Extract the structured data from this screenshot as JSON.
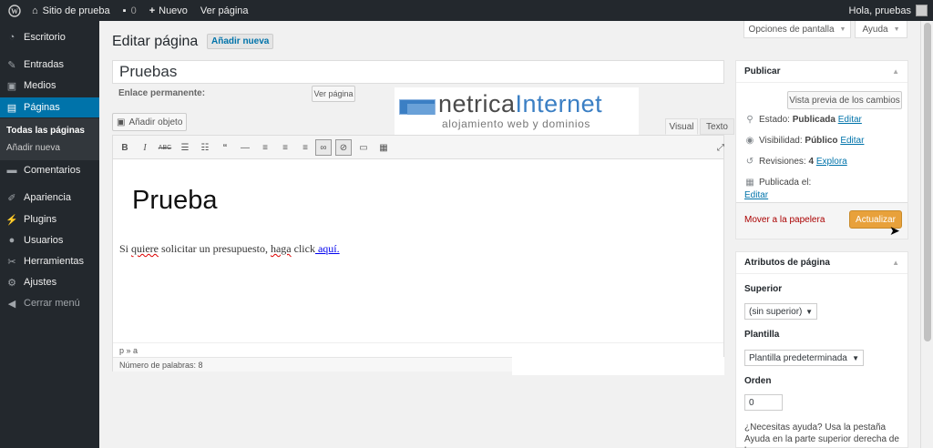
{
  "adminbar": {
    "site_name": "Sitio de prueba",
    "comments_count": "0",
    "new_label": "Nuevo",
    "view_page": "Ver página",
    "greeting": "Hola, pruebas"
  },
  "sidebar": {
    "items": [
      {
        "label": "Escritorio",
        "icon": "dashboard-icon"
      },
      {
        "label": "Entradas",
        "icon": "pin-icon"
      },
      {
        "label": "Medios",
        "icon": "media-icon"
      },
      {
        "label": "Páginas",
        "icon": "pages-icon"
      },
      {
        "label": "Comentarios",
        "icon": "comments-icon"
      },
      {
        "label": "Apariencia",
        "icon": "brush-icon"
      },
      {
        "label": "Plugins",
        "icon": "plugin-icon"
      },
      {
        "label": "Usuarios",
        "icon": "users-icon"
      },
      {
        "label": "Herramientas",
        "icon": "wrench-icon"
      },
      {
        "label": "Ajustes",
        "icon": "settings-icon"
      }
    ],
    "submenu": [
      "Todas las páginas",
      "Añadir nueva"
    ],
    "collapse": "Cerrar menú"
  },
  "screen_options": "Opciones de pantalla",
  "help": "Ayuda",
  "header": {
    "title": "Editar página",
    "add_new": "Añadir nueva"
  },
  "post": {
    "title": "Pruebas",
    "permalink_label": "Enlace permanente:",
    "view_page_button": "Ver página"
  },
  "logo": {
    "name_part1": "netrica",
    "name_part2": "Internet",
    "tagline": "alojamiento web y dominios"
  },
  "editor": {
    "add_media": "Añadir objeto",
    "tab_visual": "Visual",
    "tab_text": "Texto",
    "heading": "Prueba",
    "paragraph": {
      "w1": "Si ",
      "w2": "quiere",
      "w3": " solicitar un presupuesto, ",
      "w4": "haga",
      "w5": " click",
      "link": " aquí."
    },
    "path": "p » a",
    "word_count": "Número de palabras: 8"
  },
  "publish": {
    "title": "Publicar",
    "preview_button": "Vista previa de los cambios",
    "status_label": "Estado:",
    "status_value": "Publicada",
    "visibility_label": "Visibilidad:",
    "visibility_value": "Público",
    "revisions_label": "Revisiones:",
    "revisions_value": "4",
    "explore": "Explora",
    "published_on": "Publicada el:",
    "edit": "Editar",
    "trash": "Mover a la papelera",
    "update": "Actualizar"
  },
  "attributes": {
    "title": "Atributos de página",
    "parent_label": "Superior",
    "parent_value": "(sin superior)",
    "template_label": "Plantilla",
    "template_value": "Plantilla predeterminada",
    "order_label": "Orden",
    "order_value": "0",
    "help_text": "¿Necesitas ayuda? Usa la pestaña Ayuda en la parte superior derecha de la"
  }
}
